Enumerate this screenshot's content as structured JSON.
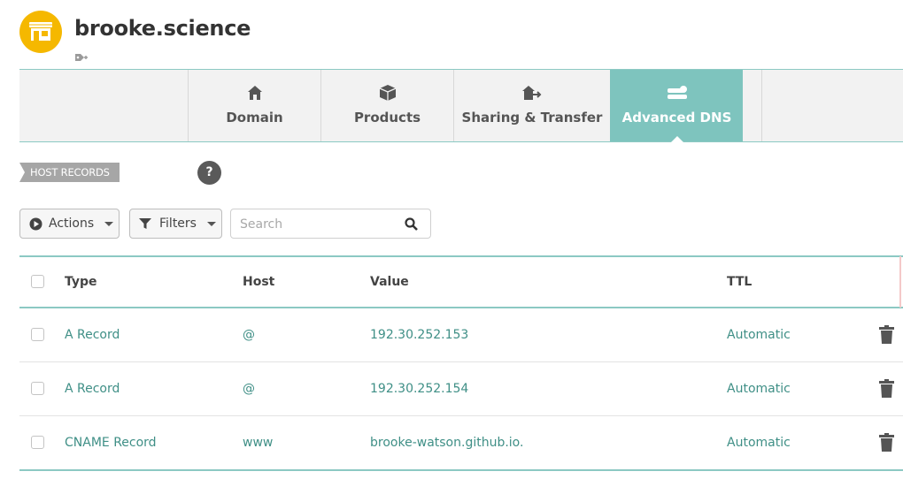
{
  "site": {
    "domain_name": "brooke.science"
  },
  "tabs": [
    {
      "label": "Domain",
      "icon": "home-icon",
      "active": false
    },
    {
      "label": "Products",
      "icon": "box-icon",
      "active": false
    },
    {
      "label": "Sharing & Transfer",
      "icon": "house-arrow-icon",
      "active": false
    },
    {
      "label": "Advanced DNS",
      "icon": "server-icon",
      "active": true
    }
  ],
  "section": {
    "title": "HOST RECORDS",
    "help_label": "?"
  },
  "toolbar": {
    "actions_label": "Actions",
    "filters_label": "Filters",
    "search_placeholder": "Search"
  },
  "table": {
    "columns": [
      "Type",
      "Host",
      "Value",
      "TTL"
    ],
    "rows": [
      {
        "type": "A Record",
        "host": "@",
        "value": "192.30.252.153",
        "ttl": "Automatic"
      },
      {
        "type": "A Record",
        "host": "@",
        "value": "192.30.252.154",
        "ttl": "Automatic"
      },
      {
        "type": "CNAME Record",
        "host": "www",
        "value": "brooke-watson.github.io.",
        "ttl": "Automatic"
      }
    ]
  },
  "colors": {
    "accent": "#7ec4be",
    "link": "#3f8f86",
    "logo": "#f5b800"
  }
}
